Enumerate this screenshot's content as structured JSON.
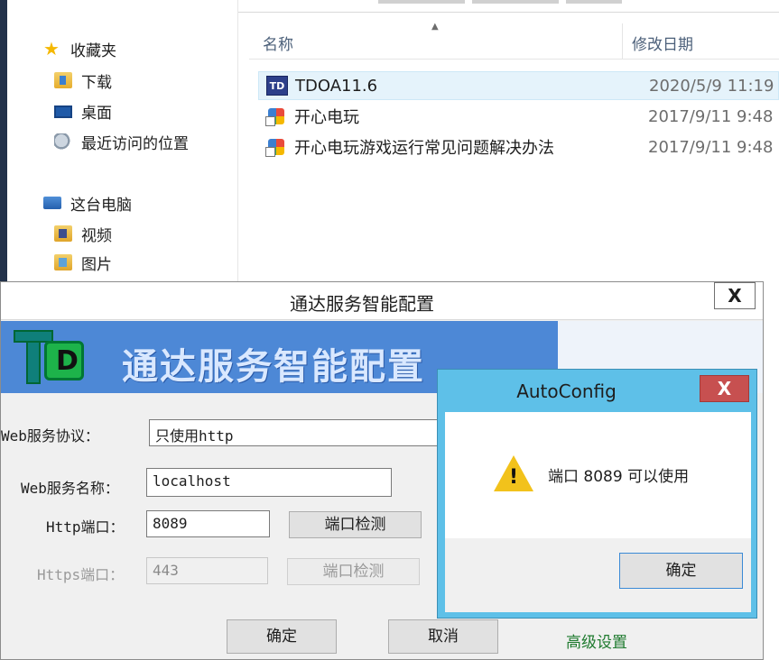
{
  "explorer": {
    "nav": {
      "favorites_label": "收藏夹",
      "items": [
        {
          "label": "下载"
        },
        {
          "label": "桌面"
        },
        {
          "label": "最近访问的位置"
        }
      ],
      "this_pc_label": "这台电脑",
      "pc_items": [
        {
          "label": "视频"
        },
        {
          "label": "图片"
        }
      ]
    },
    "columns": {
      "name": "名称",
      "date": "修改日期"
    },
    "files": [
      {
        "name": "TDOA11.6",
        "date": "2020/5/9 11:19",
        "icon": "td-app-icon",
        "icon_text": "TD"
      },
      {
        "name": "开心电玩",
        "date": "2017/9/11 9:48",
        "icon": "shortcut-icon"
      },
      {
        "name": "开心电玩游戏运行常见问题解决办法",
        "date": "2017/9/11 9:48",
        "icon": "shortcut-icon"
      }
    ]
  },
  "td_dialog": {
    "title": "通达服务智能配置",
    "close_label": "X",
    "banner_title": "通达服务智能配置",
    "web_protocol": {
      "label": "Web服务协议：",
      "value": "只使用http"
    },
    "web_name": {
      "label": "Web服务名称：",
      "value": "localhost"
    },
    "http_port": {
      "label": "Http端口：",
      "value": "8089",
      "check_label": "端口检测"
    },
    "https_port": {
      "label": "Https端口：",
      "value": "443",
      "check_label": "端口检测"
    },
    "ok_label": "确定",
    "cancel_label": "取消",
    "advanced_label": "高级设置"
  },
  "autoconfig": {
    "title": "AutoConfig",
    "close_label": "X",
    "message": "端口 8089 可以使用",
    "ok_label": "确定"
  },
  "colors": {
    "banner_blue": "#4d88d6",
    "dialog_frame": "#5ec0e8",
    "close_red": "#c75050",
    "selection": "#e5f3fb",
    "link_green": "#1e7a2e"
  }
}
